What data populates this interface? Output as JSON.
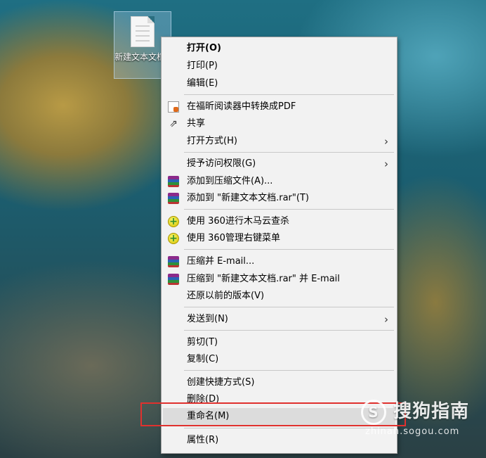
{
  "desktop": {
    "file_icon_label": "新建文本文档.txt",
    "file_icon_name": "text-file-icon"
  },
  "context_menu": {
    "items": [
      {
        "label": "打开(O)",
        "bold": true
      },
      {
        "label": "打印(P)"
      },
      {
        "label": "编辑(E)"
      },
      {
        "label": "在福昕阅读器中转换成PDF",
        "icon": "foxit-pdf-icon"
      },
      {
        "label": "共享",
        "icon": "share-icon"
      },
      {
        "label": "打开方式(H)",
        "submenu": true
      },
      {
        "label": "授予访问权限(G)",
        "submenu": true
      },
      {
        "label": "添加到压缩文件(A)...",
        "icon": "winrar-icon"
      },
      {
        "label": "添加到 \"新建文本文档.rar\"(T)",
        "icon": "winrar-icon"
      },
      {
        "label": "使用 360进行木马云查杀",
        "icon": "360-security-icon"
      },
      {
        "label": "使用 360管理右键菜单",
        "icon": "360-security-icon"
      },
      {
        "label": "压缩并 E-mail...",
        "icon": "winrar-icon"
      },
      {
        "label": "压缩到 \"新建文本文档.rar\" 并 E-mail",
        "icon": "winrar-icon"
      },
      {
        "label": "还原以前的版本(V)"
      },
      {
        "label": "发送到(N)",
        "submenu": true
      },
      {
        "label": "剪切(T)"
      },
      {
        "label": "复制(C)"
      },
      {
        "label": "创建快捷方式(S)"
      },
      {
        "label": "删除(D)"
      },
      {
        "label": "重命名(M)",
        "highlighted": true
      },
      {
        "label": "属性(R)"
      }
    ],
    "submenu_arrow": "›"
  },
  "watermark": {
    "logo_glyph": "S",
    "text": "搜狗指南",
    "url": "zhinan.sogou.com"
  },
  "colors": {
    "menu_bg": "#f2f2f2",
    "highlight_border": "#e0312e",
    "hover_bg": "#dcdcdc"
  }
}
